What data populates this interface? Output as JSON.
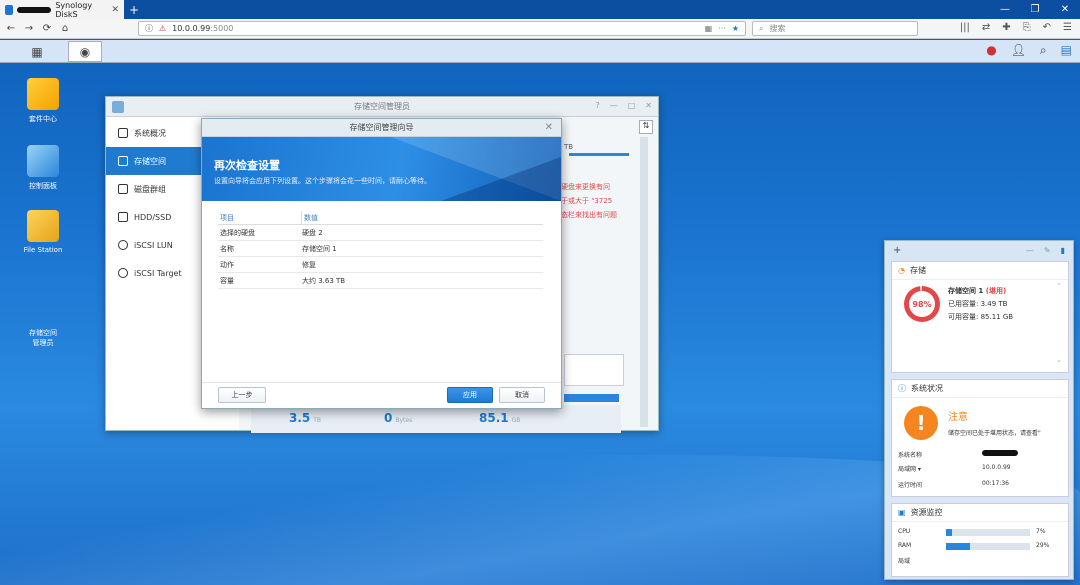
{
  "browser": {
    "tab_title": "Synology DiskS",
    "url_host": "10.0.0.99",
    "url_port": ":5000",
    "search_placeholder": "搜索"
  },
  "desktop": {
    "icons": [
      {
        "label": "套件中心"
      },
      {
        "label": "控制面板"
      },
      {
        "label": "File Station"
      },
      {
        "label": "存储空间\n管理员"
      }
    ]
  },
  "window": {
    "title": "存储空间管理员",
    "sidebar": [
      {
        "label": "系统概况"
      },
      {
        "label": "存储空间"
      },
      {
        "label": "磁盘群组"
      },
      {
        "label": "HDD/SSD"
      },
      {
        "label": "iSCSI LUN"
      },
      {
        "label": "iSCSI Target"
      }
    ],
    "bg_fragments": {
      "tb": "TB",
      "red1": "硬盘来更换有问",
      "red2": "于或大于 \"3725",
      "red3": "态栏来找出有问题",
      "stat1_value": "3.5",
      "stat1_unit": "TB",
      "stat2_value": "0",
      "stat2_unit": "Bytes",
      "stat3_value": "85.1",
      "stat3_unit": "GB"
    }
  },
  "dialog": {
    "title": "存储空间管理向导",
    "heading": "再次检查设置",
    "subheading": "设置向导将会应用下列设置。这个步骤将会花一些时间，请耐心等待。",
    "table": {
      "col_item": "项目",
      "col_value": "数值",
      "rows": [
        {
          "item": "选择的硬盘",
          "value": "硬盘 2"
        },
        {
          "item": "名称",
          "value": "存储空间 1"
        },
        {
          "item": "动作",
          "value": "修复"
        },
        {
          "item": "容量",
          "value": "大约 3.63 TB"
        }
      ]
    },
    "buttons": {
      "back": "上一步",
      "apply": "应用",
      "cancel": "取消"
    }
  },
  "widgets": {
    "storage": {
      "title": "存储",
      "percent": "98%",
      "volume": "存储空间 1",
      "status": "(堪用)",
      "used_label": "已用容量:",
      "used_value": "3.49 TB",
      "avail_label": "可用容量:",
      "avail_value": "85.11 GB"
    },
    "system": {
      "title": "系统状况",
      "status": "注意",
      "message": "储存空间已处于堪用状态，请查看\"",
      "rows": [
        {
          "label": "系统名称",
          "value": ""
        },
        {
          "label": "局域网",
          "value": "10.0.0.99"
        },
        {
          "label": "运行时间",
          "value": "00:17:36"
        }
      ]
    },
    "monitor": {
      "title": "资源监控",
      "cpu_label": "CPU",
      "cpu_value": "7%",
      "cpu_fraction": 0.07,
      "ram_label": "RAM",
      "ram_value": "29%",
      "ram_fraction": 0.29,
      "net_label": "局域"
    }
  },
  "colors": {
    "accent": "#1f7bd0",
    "warning": "#f5851e",
    "danger": "#e24848"
  }
}
